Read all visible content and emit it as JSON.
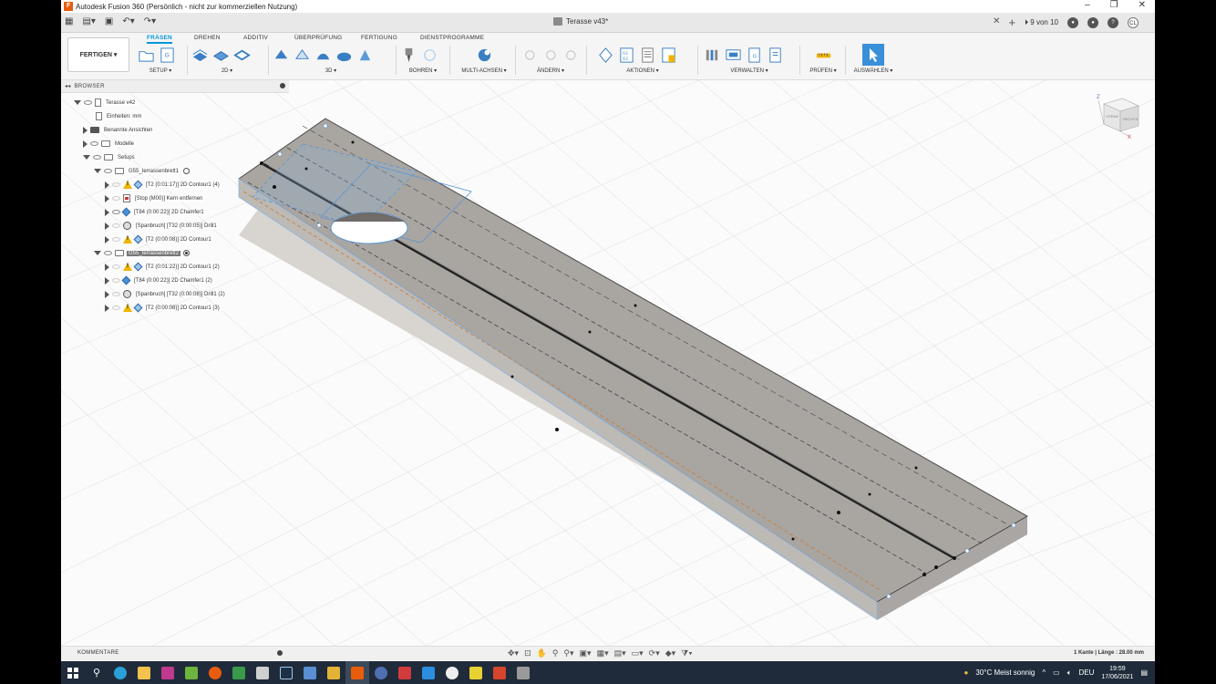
{
  "window": {
    "title": "Autodesk Fusion 360 (Persönlich - nicht zur kommerziellen Nutzung)",
    "controls": [
      "–",
      "❐",
      "✕"
    ]
  },
  "tabbar": {
    "document_title": "Terasse v43*",
    "jobs": "9 von 10",
    "user_initials": "CL"
  },
  "ribbon": {
    "workspace": "FERTIGEN ▾",
    "tabs": [
      "FRÄSEN",
      "DREHEN",
      "ADDITIV",
      "ÜBERPRÜFUNG",
      "FERTIGUNG",
      "DIENSTPROGRAMME"
    ],
    "groups": [
      "SETUP ▾",
      "2D ▾",
      "3D ▾",
      "BOHREN ▾",
      "MULTI-ACHSEN ▾",
      "ÄNDERN ▾",
      "AKTIONEN ▾",
      "VERWALTEN ▾",
      "PRÜFEN ▾",
      "AUSWÄHLEN ▾"
    ]
  },
  "browser": {
    "header": "BROWSER",
    "nodes": [
      {
        "label": "Terasse v42"
      },
      {
        "label": "Einheiten: mm"
      },
      {
        "label": "Benannte Ansichten"
      },
      {
        "label": "Modelle"
      },
      {
        "label": "Setups"
      },
      {
        "label": "G55_terrassenbrett1"
      },
      {
        "label": "[T2 (0:01:17)] 2D Contour1 (4)"
      },
      {
        "label": "[Stop (M00)] Kern entfernen"
      },
      {
        "label": "[T84 (0:00:22)] 2D Chamfer1"
      },
      {
        "label": "[Spanbruch] [T32 (0:00:05)] Drill1"
      },
      {
        "label": "[T2 (0:00:08)] 2D Contour1"
      },
      {
        "label": "G55_terrassenbrett2"
      },
      {
        "label": "[T2 (0:01:22)] 2D Contour1 (2)"
      },
      {
        "label": "[T84 (0:00:22)] 2D Chamfer1 (2)"
      },
      {
        "label": "[Spanbruch] [T32 (0:00:08)] Drill1 (2)"
      },
      {
        "label": "[T2 (0:00:08)] 2D Contour1 (3)"
      }
    ]
  },
  "bottombar": {
    "comments": "KOMMENTARE",
    "status": "1 Kante | Länge : 28.00 mm"
  },
  "taskbar": {
    "weather": "30°C  Meist sonnig",
    "language": "DEU",
    "time": "19:59",
    "date": "17/06/2021"
  },
  "colors": {
    "accent": "#0696d7",
    "warning": "#f0b400",
    "taskbar": "#1f2b3a"
  }
}
